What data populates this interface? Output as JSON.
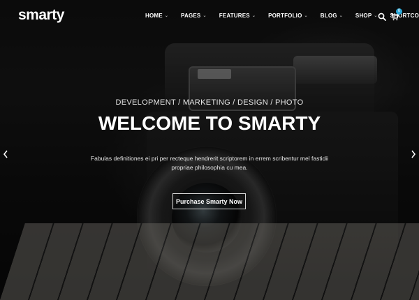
{
  "header": {
    "logo": "smarty",
    "nav": [
      {
        "label": "HOME"
      },
      {
        "label": "PAGES"
      },
      {
        "label": "FEATURES"
      },
      {
        "label": "PORTFOLIO"
      },
      {
        "label": "BLOG"
      },
      {
        "label": "SHOP"
      },
      {
        "label": "SHORTCODES"
      }
    ],
    "cart_count": "0",
    "icons": [
      "search-icon",
      "cart-icon",
      "chevron-down-icon"
    ]
  },
  "hero": {
    "subtitle": "DEVELOPMENT / MARKETING / DESIGN / PHOTO",
    "headline": "WELCOME TO SMARTY",
    "description": "Fabulas definitiones ei pri per recteque hendrerit scriptorem in errem scribentur mel fastidii propriae philosophia cu mea.",
    "cta_label": "Purchase Smarty Now",
    "icons": [
      "arrow-left-icon",
      "arrow-right-icon"
    ]
  },
  "colors": {
    "accent": "#2aa8d8",
    "text": "#ffffff",
    "background": "#0b0b0b"
  }
}
